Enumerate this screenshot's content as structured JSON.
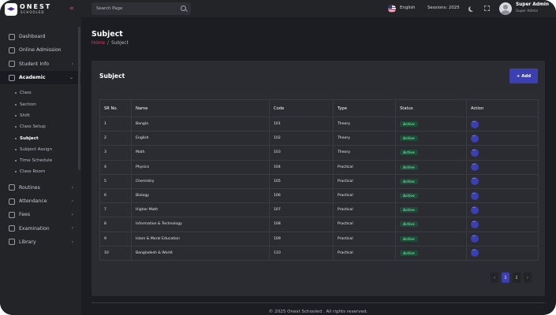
{
  "brand": {
    "name": "ONEST",
    "sub": "SCHOOLED"
  },
  "sidebar": {
    "items_top": [
      {
        "label": "Dashboard",
        "icon": "dashboard-icon"
      },
      {
        "label": "Online Admission",
        "icon": "user-icon"
      },
      {
        "label": "Student Info",
        "icon": "users-icon",
        "chevron": true
      },
      {
        "label": "Academic",
        "icon": "graduation-cap-icon",
        "chevron": true,
        "active": true
      }
    ],
    "submenu": [
      "Class",
      "Section",
      "Shift",
      "Class Setup",
      "Subject",
      "Subject Assign",
      "Time Schedule",
      "Class Room"
    ],
    "submenu_current": "Subject",
    "items_bottom": [
      {
        "label": "Routines",
        "icon": "calendar-icon"
      },
      {
        "label": "Attendance",
        "icon": "attendance-icon"
      },
      {
        "label": "Fees",
        "icon": "fees-icon"
      },
      {
        "label": "Examination",
        "icon": "exam-icon"
      },
      {
        "label": "Library",
        "icon": "library-icon"
      }
    ]
  },
  "topbar": {
    "search_placeholder": "Search Page",
    "language": "English",
    "session": "Sessions: 2025",
    "user_name": "Super Admin",
    "user_role": "Super Admin"
  },
  "page": {
    "title": "Subject",
    "breadcrumb_home": "Home",
    "breadcrumb_separator": "/",
    "breadcrumb_current": "Subject"
  },
  "card": {
    "title": "Subject",
    "add_label": "+ Add"
  },
  "table": {
    "columns": [
      "SR No.",
      "Name",
      "Code",
      "Type",
      "Status",
      "Action"
    ],
    "rows": [
      {
        "sr": "1",
        "name": "Bangla",
        "code": "101",
        "type": "Theory",
        "status": "Active"
      },
      {
        "sr": "2",
        "name": "English",
        "code": "102",
        "type": "Theory",
        "status": "Active"
      },
      {
        "sr": "3",
        "name": "Math",
        "code": "103",
        "type": "Theory",
        "status": "Active"
      },
      {
        "sr": "4",
        "name": "Physics",
        "code": "104",
        "type": "Practical",
        "status": "Active"
      },
      {
        "sr": "5",
        "name": "Chemistry",
        "code": "105",
        "type": "Practical",
        "status": "Active"
      },
      {
        "sr": "6",
        "name": "Biology",
        "code": "106",
        "type": "Practical",
        "status": "Active"
      },
      {
        "sr": "7",
        "name": "Higher Math",
        "code": "107",
        "type": "Practical",
        "status": "Active"
      },
      {
        "sr": "8",
        "name": "Information & Technology",
        "code": "108",
        "type": "Practical",
        "status": "Active"
      },
      {
        "sr": "9",
        "name": "Islam & Moral Education",
        "code": "109",
        "type": "Practical",
        "status": "Active"
      },
      {
        "sr": "10",
        "name": "Bangladesh & World",
        "code": "110",
        "type": "Practical",
        "status": "Active"
      }
    ]
  },
  "pagination": {
    "prev": "‹",
    "pages": [
      "1",
      "2"
    ],
    "current": "1",
    "next": "›"
  },
  "footer": "© 2025 Onest Schooled . All rights reserved.",
  "colors": {
    "accent": "#3b3fb0",
    "brand_red": "#e0365b",
    "status_active": "#4fd08a",
    "background": "#1c1d22",
    "panel": "#2b2c31"
  }
}
